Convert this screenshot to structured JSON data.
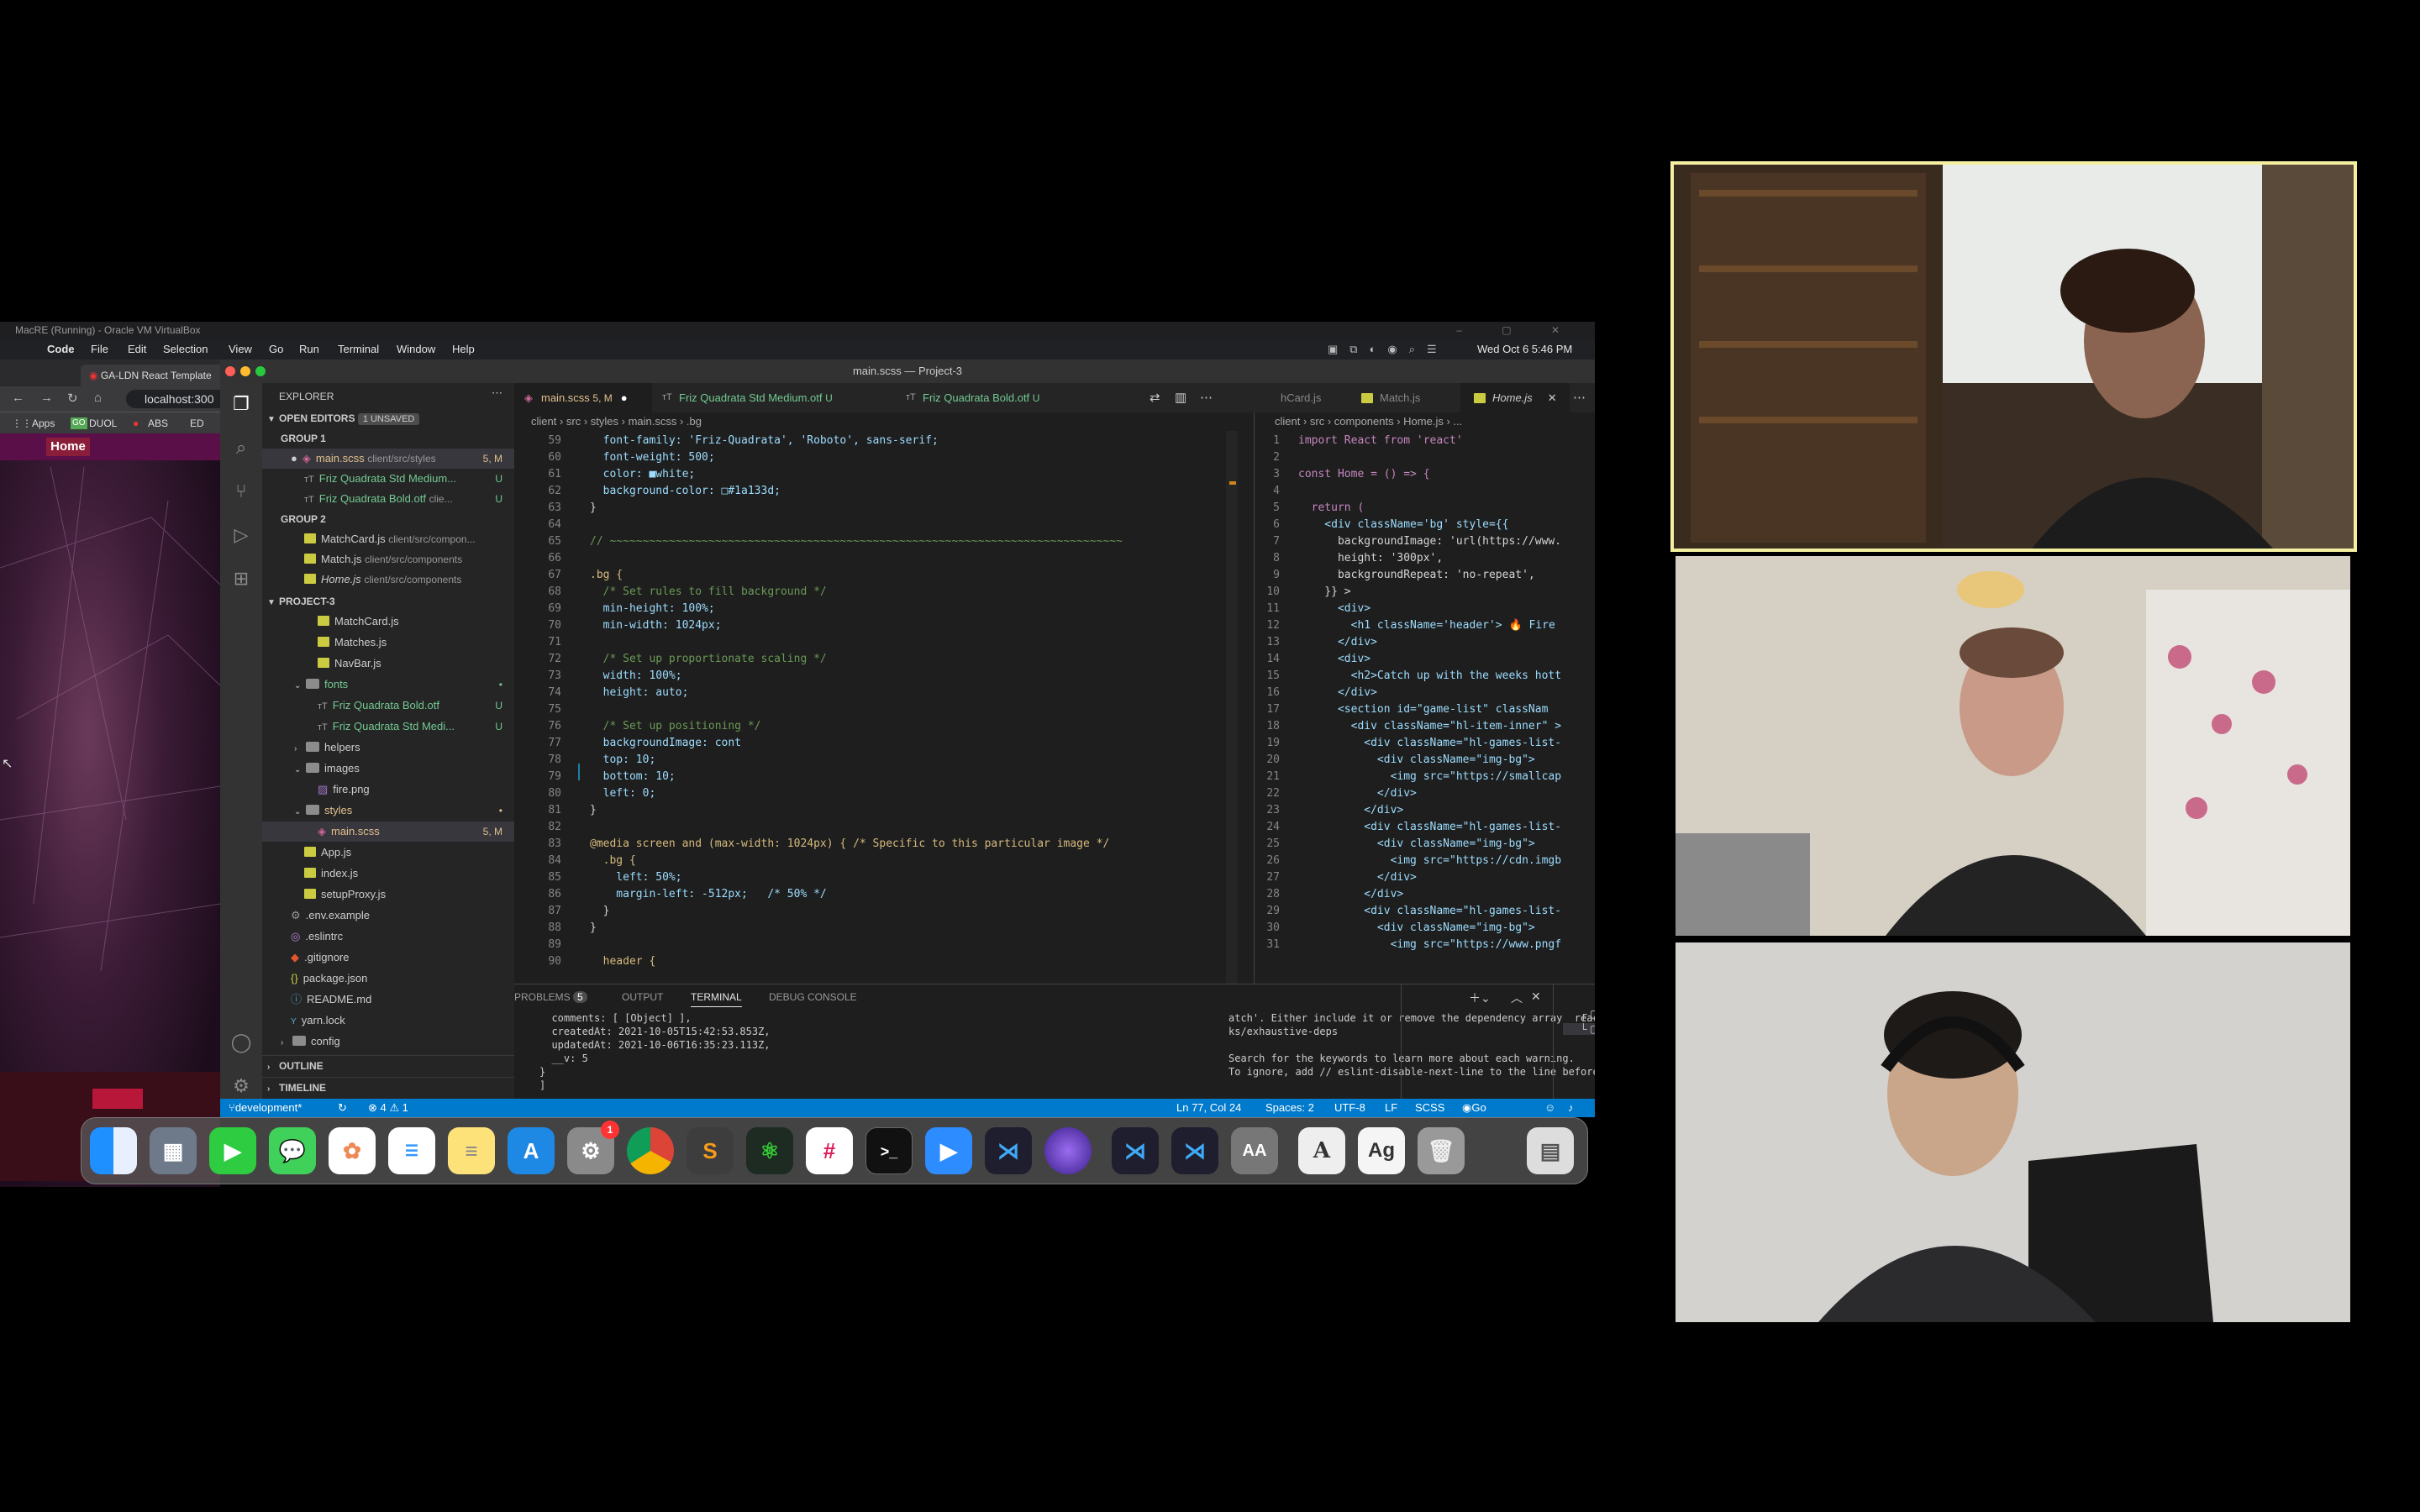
{
  "virtualbox": {
    "title": "MacRE (Running) - Oracle VM VirtualBox"
  },
  "mac_menubar": {
    "app": "Code",
    "items": [
      "File",
      "Edit",
      "Selection",
      "View",
      "Go",
      "Run",
      "Terminal",
      "Window",
      "Help"
    ],
    "clock": "Wed Oct 6  5:46 PM"
  },
  "browser": {
    "tab_title": "GA-LDN React Template",
    "url": "localhost:300",
    "bookmarks": [
      "Apps",
      "DUOL",
      "ABS",
      "ED"
    ],
    "home_button": "Home"
  },
  "vscode": {
    "window_title": "main.scss — Project-3",
    "explorer": {
      "header": "EXPLORER",
      "open_editors_label": "OPEN EDITORS",
      "unsaved_badge": "1 UNSAVED",
      "group1_label": "GROUP 1",
      "group1": [
        {
          "name": "main.scss",
          "path": "client/src/styles",
          "badge": "5, M"
        },
        {
          "name": "Friz Quadrata Std Medium...",
          "path": "",
          "badge": "U"
        },
        {
          "name": "Friz Quadrata Bold.otf",
          "path": "clie...",
          "badge": "U"
        }
      ],
      "group2_label": "GROUP 2",
      "group2": [
        {
          "name": "MatchCard.js",
          "path": "client/src/compon...",
          "badge": ""
        },
        {
          "name": "Match.js",
          "path": "client/src/components",
          "badge": ""
        },
        {
          "name": "Home.js",
          "path": "client/src/components",
          "badge": ""
        }
      ],
      "project_label": "PROJECT-3",
      "tree": [
        {
          "name": "MatchCard.js",
          "badge": ""
        },
        {
          "name": "Matches.js",
          "badge": ""
        },
        {
          "name": "NavBar.js",
          "badge": ""
        },
        {
          "name": "fonts",
          "badge": "•"
        },
        {
          "name": "Friz Quadrata Bold.otf",
          "badge": "U"
        },
        {
          "name": "Friz Quadrata Std Medi...",
          "badge": "U"
        },
        {
          "name": "helpers",
          "badge": ""
        },
        {
          "name": "images",
          "badge": ""
        },
        {
          "name": "fire.png",
          "badge": ""
        },
        {
          "name": "styles",
          "badge": "•"
        },
        {
          "name": "main.scss",
          "badge": "5, M"
        },
        {
          "name": "App.js",
          "badge": ""
        },
        {
          "name": "index.js",
          "badge": ""
        },
        {
          "name": "setupProxy.js",
          "badge": ""
        },
        {
          "name": ".env.example",
          "badge": ""
        },
        {
          "name": ".eslintrc",
          "badge": ""
        },
        {
          "name": ".gitignore",
          "badge": ""
        },
        {
          "name": "package.json",
          "badge": ""
        },
        {
          "name": "README.md",
          "badge": ""
        },
        {
          "name": "yarn.lock",
          "badge": ""
        },
        {
          "name": "config",
          "badge": ""
        }
      ],
      "outline_label": "OUTLINE",
      "timeline_label": "TIMELINE"
    },
    "editor1": {
      "tabs": [
        {
          "label": "main.scss",
          "extra": "5, M"
        },
        {
          "label": "Friz Quadrata Std Medium.otf",
          "extra": "U"
        },
        {
          "label": "Friz Quadrata Bold.otf",
          "extra": "U"
        }
      ],
      "breadcrumb": "client › src › styles › main.scss › .bg",
      "lines": [
        {
          "n": "59",
          "t": "  font-family: 'Friz-Quadrata', 'Roboto', sans-serif;"
        },
        {
          "n": "60",
          "t": "  font-weight: 500;"
        },
        {
          "n": "61",
          "t": "  color: ■white;"
        },
        {
          "n": "62",
          "t": "  background-color: □#1a133d;"
        },
        {
          "n": "63",
          "t": "}"
        },
        {
          "n": "64",
          "t": ""
        },
        {
          "n": "65",
          "t": "// ~~~~~~~~~~~~~~~~~~~~~~~~~~~~~~~~~~~~~~~~~~~~~~~~~~~~~~~~~~~~~~~~~~~~~~~~~~~~~~"
        },
        {
          "n": "66",
          "t": ""
        },
        {
          "n": "67",
          "t": ".bg {"
        },
        {
          "n": "68",
          "t": "  /* Set rules to fill background */"
        },
        {
          "n": "69",
          "t": "  min-height: 100%;"
        },
        {
          "n": "70",
          "t": "  min-width: 1024px;"
        },
        {
          "n": "71",
          "t": ""
        },
        {
          "n": "72",
          "t": "  /* Set up proportionate scaling */"
        },
        {
          "n": "73",
          "t": "  width: 100%;"
        },
        {
          "n": "74",
          "t": "  height: auto;"
        },
        {
          "n": "75",
          "t": ""
        },
        {
          "n": "76",
          "t": "  /* Set up positioning */"
        },
        {
          "n": "77",
          "t": "  backgroundImage: cont"
        },
        {
          "n": "78",
          "t": "  top: 10;"
        },
        {
          "n": "79",
          "t": "  bottom: 10;"
        },
        {
          "n": "80",
          "t": "  left: 0;"
        },
        {
          "n": "81",
          "t": "}"
        },
        {
          "n": "82",
          "t": ""
        },
        {
          "n": "83",
          "t": "@media screen and (max-width: 1024px) { /* Specific to this particular image */"
        },
        {
          "n": "84",
          "t": "  .bg {"
        },
        {
          "n": "85",
          "t": "    left: 50%;"
        },
        {
          "n": "86",
          "t": "    margin-left: -512px;   /* 50% */"
        },
        {
          "n": "87",
          "t": "  }"
        },
        {
          "n": "88",
          "t": "}"
        },
        {
          "n": "89",
          "t": ""
        },
        {
          "n": "90",
          "t": "  header {"
        }
      ]
    },
    "editor2": {
      "tabs": [
        "hCard.js",
        "Match.js",
        "Home.js"
      ],
      "breadcrumb": "client › src › components › Home.js › ...",
      "lines": [
        {
          "n": "1",
          "t": "import React from 'react'"
        },
        {
          "n": "2",
          "t": ""
        },
        {
          "n": "3",
          "t": "const Home = () => {"
        },
        {
          "n": "4",
          "t": ""
        },
        {
          "n": "5",
          "t": "  return ("
        },
        {
          "n": "6",
          "t": "    <div className='bg' style={{"
        },
        {
          "n": "7",
          "t": "      backgroundImage: 'url(https://www."
        },
        {
          "n": "8",
          "t": "      height: '300px',"
        },
        {
          "n": "9",
          "t": "      backgroundRepeat: 'no-repeat',"
        },
        {
          "n": "10",
          "t": "    }} >"
        },
        {
          "n": "11",
          "t": "      <div>"
        },
        {
          "n": "12",
          "t": "        <h1 className='header'> 🔥 Fire"
        },
        {
          "n": "13",
          "t": "      </div>"
        },
        {
          "n": "14",
          "t": "      <div>"
        },
        {
          "n": "15",
          "t": "        <h2>Catch up with the weeks hott"
        },
        {
          "n": "16",
          "t": "      </div>"
        },
        {
          "n": "17",
          "t": "      <section id=\"game-list\" classNam"
        },
        {
          "n": "18",
          "t": "        <div className=\"hl-item-inner\" >"
        },
        {
          "n": "19",
          "t": "          <div className=\"hl-games-list-"
        },
        {
          "n": "20",
          "t": "            <div className=\"img-bg\">"
        },
        {
          "n": "21",
          "t": "              <img src=\"https://smallcap"
        },
        {
          "n": "22",
          "t": "            </div>"
        },
        {
          "n": "23",
          "t": "          </div>"
        },
        {
          "n": "24",
          "t": "          <div className=\"hl-games-list-"
        },
        {
          "n": "25",
          "t": "            <div className=\"img-bg\">"
        },
        {
          "n": "26",
          "t": "              <img src=\"https://cdn.imgb"
        },
        {
          "n": "27",
          "t": "            </div>"
        },
        {
          "n": "28",
          "t": "          </div>"
        },
        {
          "n": "29",
          "t": "          <div className=\"hl-games-list-"
        },
        {
          "n": "30",
          "t": "            <div className=\"img-bg\">"
        },
        {
          "n": "31",
          "t": "              <img src=\"https://www.pngf"
        }
      ]
    },
    "panel": {
      "tabs": [
        "PROBLEMS",
        "OUTPUT",
        "TERMINAL",
        "DEBUG CONSOLE"
      ],
      "problems_count": "5",
      "terminal_left": [
        "  comments: [ [Object] ],",
        "  createdAt: 2021-10-05T15:42:53.853Z,",
        "  updatedAt: 2021-10-06T16:35:23.113Z,",
        "  __v: 5",
        "}",
        "]"
      ],
      "terminal_right": [
        "atch'. Either include it or remove the dependency array  react-hoo",
        "ks/exhaustive-deps",
        "",
        "Search for the keywords to learn more about each warning.",
        "To ignore, add // eslint-disable-next-line to the line before."
      ],
      "terminal_list": [
        "node",
        "node"
      ]
    },
    "statusbar": {
      "branch": "development*",
      "problems": "⊗ 4  ⚠ 1",
      "position": "Ln 77, Col 24",
      "spaces": "Spaces: 2",
      "encoding": "UTF-8",
      "eol": "LF",
      "language": "SCSS",
      "golive": "Go Live"
    }
  },
  "dock": {
    "apps": [
      "finder-icon",
      "launchpad-icon",
      "facetime-icon",
      "messages-icon",
      "photos-icon",
      "reminders-icon",
      "notes-icon",
      "app-store-icon",
      "system-preferences-icon",
      "chrome-icon",
      "sublime-icon",
      "atom-icon",
      "slack-icon",
      "terminal-icon",
      "zoom-icon",
      "vscode-icon",
      "firefox-icon",
      "vscode-alt-icon",
      "vscode-insiders-icon",
      "font-book-icon",
      "dictionary-icon",
      "font-preview-icon",
      "trash-icon",
      "file-icon"
    ],
    "sys_prefs_badge": "1"
  },
  "colors": {
    "accent": "#007acc",
    "active_speaker": "#f4f0a0",
    "modified": "#e2c08d",
    "untracked": "#73c991"
  }
}
